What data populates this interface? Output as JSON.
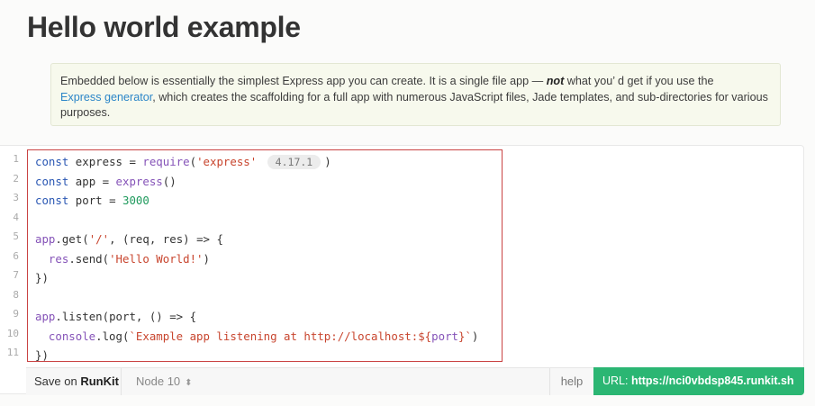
{
  "page": {
    "title": "Hello world example"
  },
  "note": {
    "text_1": "Embedded below is essentially the simplest Express app you can create. It is a single file app — ",
    "emphasis": "not",
    "text_2": " what you’ d get if you use the ",
    "link": "Express generator",
    "text_3": ", which creates the scaffolding for a full app with numerous JavaScript files, Jade templates, and sub-directories for various purposes."
  },
  "code": {
    "line_numbers": [
      "1",
      "2",
      "3",
      "4",
      "5",
      "6",
      "7",
      "8",
      "9",
      "10",
      "11"
    ],
    "version_badge": "4.17.1"
  },
  "footer": {
    "save_prefix": "Save on ",
    "save_brand": "RunKit",
    "node_version": "Node 10",
    "help": "help",
    "url_label": "URL: ",
    "url_value": "https://nci0vbdsp845.runkit.sh"
  },
  "colors": {
    "accent_green": "#2bb673",
    "link_blue": "#2c86c8",
    "selection_border": "#c94343"
  }
}
